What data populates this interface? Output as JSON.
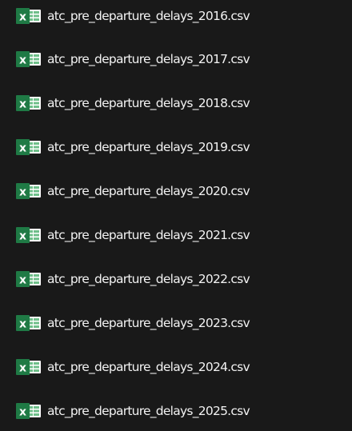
{
  "files": [
    {
      "name": "atc_pre_departure_delays_2016.csv",
      "icon": "excel-csv-icon"
    },
    {
      "name": "atc_pre_departure_delays_2017.csv",
      "icon": "excel-csv-icon"
    },
    {
      "name": "atc_pre_departure_delays_2018.csv",
      "icon": "excel-csv-icon"
    },
    {
      "name": "atc_pre_departure_delays_2019.csv",
      "icon": "excel-csv-icon"
    },
    {
      "name": "atc_pre_departure_delays_2020.csv",
      "icon": "excel-csv-icon"
    },
    {
      "name": "atc_pre_departure_delays_2021.csv",
      "icon": "excel-csv-icon"
    },
    {
      "name": "atc_pre_departure_delays_2022.csv",
      "icon": "excel-csv-icon"
    },
    {
      "name": "atc_pre_departure_delays_2023.csv",
      "icon": "excel-csv-icon"
    },
    {
      "name": "atc_pre_departure_delays_2024.csv",
      "icon": "excel-csv-icon"
    },
    {
      "name": "atc_pre_departure_delays_2025.csv",
      "icon": "excel-csv-icon"
    }
  ],
  "colors": {
    "background": "#191919",
    "text": "#f2f2f2",
    "excel_green": "#1f7a45"
  }
}
